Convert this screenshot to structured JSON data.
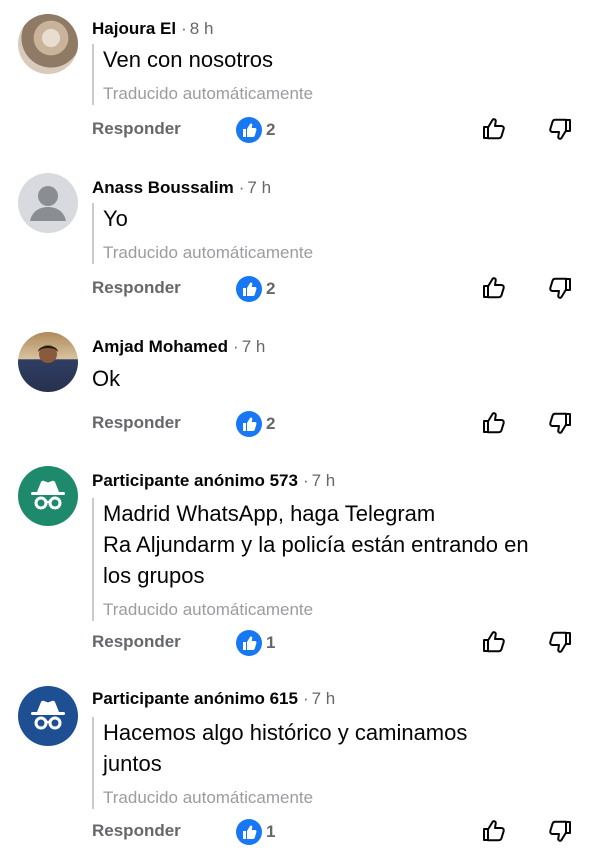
{
  "comments": [
    {
      "author": "Hajoura El",
      "separator": "·",
      "time": "8 h",
      "text": [
        "Ven con nosotros"
      ],
      "translated": "Traducido automáticamente",
      "reply_label": "Responder",
      "likes": "2",
      "avatar": "photo-avatar"
    },
    {
      "author": "Anass Boussalim",
      "separator": "·",
      "time": "7 h",
      "text": [
        "Yo"
      ],
      "translated": "Traducido automáticamente",
      "reply_label": "Responder",
      "likes": "2",
      "avatar": "default-user-icon"
    },
    {
      "author": "Amjad Mohamed",
      "separator": "·",
      "time": "7 h",
      "text": [
        "Ok"
      ],
      "translated": "",
      "reply_label": "Responder",
      "likes": "2",
      "avatar": "photo-avatar"
    },
    {
      "author": "Participante anónimo 573",
      "separator": "·",
      "time": "7 h",
      "text": [
        "Madrid WhatsApp, haga Telegram",
        "Ra Aljundarm y la policía están entrando en",
        "los grupos"
      ],
      "translated": "Traducido automáticamente",
      "reply_label": "Responder",
      "likes": "1",
      "avatar": "incognito-icon",
      "avatar_color": "#1f8a6b"
    },
    {
      "author": "Participante anónimo 615",
      "separator": "·",
      "time": "7 h",
      "text": [
        "Hacemos algo histórico y caminamos",
        "juntos"
      ],
      "translated": "Traducido automáticamente",
      "reply_label": "Responder",
      "likes": "1",
      "avatar": "incognito-icon",
      "avatar_color": "#1e4f93"
    }
  ],
  "icons": {
    "like_badge": "like-badge-icon",
    "thumb_up": "thumbs-up-icon",
    "thumb_down": "thumbs-down-icon"
  },
  "colors": {
    "like_blue": "#1877f2",
    "meta_gray": "#65676b",
    "translated_gray": "#9a9ca1"
  }
}
